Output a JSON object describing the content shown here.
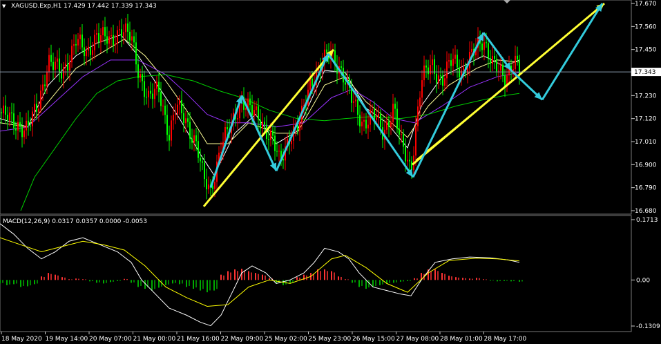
{
  "window": {
    "symbol_line": "XAGUSD.Exp,H1  17.429 17.442 17.339 17.343",
    "current_price_label": "17.343"
  },
  "colors": {
    "background": "#000000",
    "bull_candle": "#ff0000",
    "bear_candle": "#00ff00",
    "ma_fast": "#ffffff",
    "ma_mid": "#ffff99",
    "ma_slow": "#9933ff",
    "ma_long": "#00cc00",
    "trend_arrow": "#ffff33",
    "wave_arrow": "#33ccdd",
    "macd_line": "#ffffff",
    "signal_line": "#ffff00",
    "hist_pos": "#ff3333",
    "hist_neg": "#00aa00",
    "separator": "#888888",
    "price_line": "#8899aa"
  },
  "chart_data": [
    {
      "type": "candlestick",
      "symbol": "XAGUSD.Exp",
      "timeframe": "H1",
      "ohlc": {
        "open": 17.429,
        "high": 17.442,
        "low": 17.339,
        "close": 17.343
      },
      "ylim": [
        16.68,
        17.67
      ],
      "yticks": [
        16.68,
        16.79,
        16.9,
        17.01,
        17.12,
        17.23,
        17.34,
        17.45,
        17.56,
        17.67
      ],
      "ytick_labels": [
        "16.680",
        "16.790",
        "16.900",
        "17.010",
        "17.120",
        "17.230",
        "17.343",
        "17.450",
        "17.560",
        "17.670"
      ],
      "xtick_labels": [
        "18 May 2020",
        "19 May 14:00",
        "20 May 07:00",
        "21 May 00:00",
        "21 May 16:00",
        "22 May 09:00",
        "25 May 02:00",
        "25 May 23:00",
        "26 May 15:00",
        "27 May 08:00",
        "28 May 01:00",
        "28 May 17:00"
      ],
      "current_price": 17.343,
      "price_path": [
        [
          0,
          17.15
        ],
        [
          20,
          17.1
        ],
        [
          40,
          17.07
        ],
        [
          55,
          17.18
        ],
        [
          70,
          17.4
        ],
        [
          90,
          17.33
        ],
        [
          110,
          17.5
        ],
        [
          125,
          17.42
        ],
        [
          140,
          17.53
        ],
        [
          160,
          17.48
        ],
        [
          175,
          17.56
        ],
        [
          190,
          17.5
        ],
        [
          200,
          17.35
        ],
        [
          215,
          17.22
        ],
        [
          230,
          17.25
        ],
        [
          245,
          17.05
        ],
        [
          255,
          17.18
        ],
        [
          270,
          17.1
        ],
        [
          285,
          17.0
        ],
        [
          295,
          16.82
        ],
        [
          305,
          16.77
        ],
        [
          320,
          17.0
        ],
        [
          335,
          17.08
        ],
        [
          350,
          17.22
        ],
        [
          365,
          17.15
        ],
        [
          380,
          17.1
        ],
        [
          395,
          17.02
        ],
        [
          405,
          16.9
        ],
        [
          420,
          17.05
        ],
        [
          435,
          17.1
        ],
        [
          450,
          17.3
        ],
        [
          465,
          17.38
        ],
        [
          478,
          17.43
        ],
        [
          495,
          17.35
        ],
        [
          510,
          17.2
        ],
        [
          525,
          17.1
        ],
        [
          540,
          17.14
        ],
        [
          555,
          17.05
        ],
        [
          570,
          17.18
        ],
        [
          580,
          17.0
        ],
        [
          595,
          16.88
        ],
        [
          610,
          17.3
        ],
        [
          625,
          17.38
        ],
        [
          640,
          17.3
        ],
        [
          655,
          17.4
        ],
        [
          670,
          17.35
        ],
        [
          685,
          17.43
        ],
        [
          700,
          17.5
        ],
        [
          715,
          17.38
        ],
        [
          730,
          17.3
        ],
        [
          745,
          17.42
        ],
        [
          752,
          17.343
        ]
      ],
      "moving_averages": [
        {
          "key": "ma_fast",
          "points": [
            [
              0,
              17.12
            ],
            [
              40,
              17.08
            ],
            [
              70,
              17.28
            ],
            [
              110,
              17.42
            ],
            [
              140,
              17.48
            ],
            [
              175,
              17.52
            ],
            [
              200,
              17.42
            ],
            [
              230,
              17.27
            ],
            [
              260,
              17.12
            ],
            [
              290,
              16.95
            ],
            [
              310,
              16.85
            ],
            [
              340,
              17.05
            ],
            [
              370,
              17.14
            ],
            [
              400,
              17.0
            ],
            [
              430,
              17.06
            ],
            [
              470,
              17.35
            ],
            [
              500,
              17.34
            ],
            [
              530,
              17.17
            ],
            [
              560,
              17.1
            ],
            [
              590,
              16.98
            ],
            [
              610,
              17.18
            ],
            [
              640,
              17.32
            ],
            [
              670,
              17.37
            ],
            [
              700,
              17.42
            ],
            [
              730,
              17.37
            ],
            [
              752,
              17.4
            ]
          ]
        },
        {
          "key": "ma_mid",
          "points": [
            [
              0,
              17.1
            ],
            [
              40,
              17.08
            ],
            [
              70,
              17.2
            ],
            [
              110,
              17.36
            ],
            [
              150,
              17.44
            ],
            [
              180,
              17.5
            ],
            [
              210,
              17.42
            ],
            [
              240,
              17.3
            ],
            [
              270,
              17.16
            ],
            [
              300,
              17.0
            ],
            [
              330,
              17.0
            ],
            [
              360,
              17.1
            ],
            [
              400,
              17.05
            ],
            [
              430,
              17.05
            ],
            [
              470,
              17.28
            ],
            [
              500,
              17.32
            ],
            [
              530,
              17.2
            ],
            [
              560,
              17.12
            ],
            [
              590,
              17.03
            ],
            [
              620,
              17.18
            ],
            [
              650,
              17.28
            ],
            [
              690,
              17.36
            ],
            [
              720,
              17.4
            ],
            [
              752,
              17.39
            ]
          ]
        },
        {
          "key": "ma_slow",
          "points": [
            [
              0,
              17.06
            ],
            [
              40,
              17.08
            ],
            [
              80,
              17.2
            ],
            [
              120,
              17.32
            ],
            [
              160,
              17.4
            ],
            [
              200,
              17.4
            ],
            [
              240,
              17.33
            ],
            [
              270,
              17.24
            ],
            [
              300,
              17.14
            ],
            [
              330,
              17.1
            ],
            [
              360,
              17.1
            ],
            [
              400,
              17.08
            ],
            [
              440,
              17.1
            ],
            [
              480,
              17.22
            ],
            [
              510,
              17.26
            ],
            [
              540,
              17.2
            ],
            [
              570,
              17.12
            ],
            [
              600,
              17.1
            ],
            [
              640,
              17.18
            ],
            [
              680,
              17.27
            ],
            [
              720,
              17.32
            ],
            [
              752,
              17.34
            ]
          ]
        },
        {
          "key": "ma_long",
          "points": [
            [
              30,
              16.68
            ],
            [
              50,
              16.84
            ],
            [
              80,
              16.98
            ],
            [
              110,
              17.12
            ],
            [
              140,
              17.24
            ],
            [
              170,
              17.3
            ],
            [
              200,
              17.32
            ],
            [
              240,
              17.33
            ],
            [
              280,
              17.3
            ],
            [
              320,
              17.25
            ],
            [
              350,
              17.22
            ],
            [
              390,
              17.16
            ],
            [
              430,
              17.12
            ],
            [
              470,
              17.11
            ],
            [
              500,
              17.12
            ],
            [
              540,
              17.13
            ],
            [
              580,
              17.12
            ],
            [
              620,
              17.14
            ],
            [
              660,
              17.18
            ],
            [
              700,
              17.21
            ],
            [
              730,
              17.23
            ],
            [
              752,
              17.24
            ]
          ]
        }
      ],
      "annotations": {
        "trend_arrows": [
          {
            "from": [
              295,
              16.7
            ],
            "to": [
              483,
              17.45
            ]
          },
          {
            "from": [
              597,
              16.9
            ],
            "to": [
              875,
              17.67
            ]
          }
        ],
        "trend_lines": [
          {
            "from": [
              602,
              16.92
            ],
            "to": [
              760,
              17.35
            ]
          }
        ],
        "wave_path": [
          [
            305,
            16.79
          ],
          [
            350,
            17.23
          ],
          [
            400,
            16.87
          ],
          [
            475,
            17.43
          ],
          [
            598,
            16.84
          ],
          [
            700,
            17.53
          ],
          [
            740,
            17.35
          ],
          [
            785,
            17.21
          ],
          [
            872,
            17.67
          ]
        ]
      }
    },
    {
      "type": "macd",
      "title": "MACD(12,26,9) 0.0317 0.0357 0.0000 -0.0053",
      "ylim": [
        -0.1309,
        0.1713
      ],
      "yticks": [
        0.1713,
        0.0,
        -0.1309
      ],
      "ytick_labels": [
        "0.1713",
        "0.00",
        "-0.1309"
      ],
      "macd_line": [
        [
          0,
          0.16
        ],
        [
          20,
          0.13
        ],
        [
          40,
          0.09
        ],
        [
          60,
          0.06
        ],
        [
          80,
          0.08
        ],
        [
          100,
          0.11
        ],
        [
          120,
          0.12
        ],
        [
          145,
          0.1
        ],
        [
          170,
          0.08
        ],
        [
          190,
          0.05
        ],
        [
          205,
          0.0
        ],
        [
          225,
          -0.04
        ],
        [
          245,
          -0.08
        ],
        [
          270,
          -0.1
        ],
        [
          290,
          -0.12
        ],
        [
          305,
          -0.13
        ],
        [
          320,
          -0.1
        ],
        [
          335,
          -0.04
        ],
        [
          350,
          0.02
        ],
        [
          365,
          0.04
        ],
        [
          385,
          0.02
        ],
        [
          400,
          -0.01
        ],
        [
          420,
          0.0
        ],
        [
          440,
          0.02
        ],
        [
          455,
          0.05
        ],
        [
          470,
          0.09
        ],
        [
          490,
          0.08
        ],
        [
          505,
          0.06
        ],
        [
          520,
          0.02
        ],
        [
          540,
          -0.02
        ],
        [
          560,
          -0.03
        ],
        [
          580,
          -0.04
        ],
        [
          595,
          -0.045
        ],
        [
          610,
          0.0
        ],
        [
          630,
          0.05
        ],
        [
          655,
          0.06
        ],
        [
          680,
          0.065
        ],
        [
          710,
          0.063
        ],
        [
          735,
          0.057
        ],
        [
          752,
          0.05
        ]
      ],
      "signal_line": [
        [
          0,
          0.12
        ],
        [
          30,
          0.1
        ],
        [
          60,
          0.08
        ],
        [
          90,
          0.095
        ],
        [
          120,
          0.11
        ],
        [
          150,
          0.1
        ],
        [
          180,
          0.085
        ],
        [
          210,
          0.04
        ],
        [
          240,
          -0.02
        ],
        [
          270,
          -0.05
        ],
        [
          300,
          -0.075
        ],
        [
          330,
          -0.07
        ],
        [
          360,
          -0.02
        ],
        [
          390,
          0.0
        ],
        [
          420,
          -0.01
        ],
        [
          450,
          0.01
        ],
        [
          480,
          0.06
        ],
        [
          500,
          0.07
        ],
        [
          530,
          0.035
        ],
        [
          560,
          -0.01
        ],
        [
          590,
          -0.035
        ],
        [
          620,
          0.02
        ],
        [
          650,
          0.055
        ],
        [
          690,
          0.062
        ],
        [
          720,
          0.06
        ],
        [
          752,
          0.054
        ]
      ],
      "histogram": [
        [
          0,
          -0.01
        ],
        [
          10,
          -0.015
        ],
        [
          20,
          -0.012
        ],
        [
          30,
          -0.02
        ],
        [
          40,
          -0.018
        ],
        [
          50,
          -0.012
        ],
        [
          60,
          0.01
        ],
        [
          70,
          0.02
        ],
        [
          80,
          0.015
        ],
        [
          90,
          0.008
        ],
        [
          100,
          0.002
        ],
        [
          110,
          0.004
        ],
        [
          120,
          0.002
        ],
        [
          130,
          -0.004
        ],
        [
          140,
          -0.008
        ],
        [
          150,
          -0.01
        ],
        [
          160,
          -0.006
        ],
        [
          170,
          -0.003
        ],
        [
          180,
          0.003
        ],
        [
          190,
          -0.008
        ],
        [
          200,
          -0.02
        ],
        [
          210,
          -0.025
        ],
        [
          220,
          -0.03
        ],
        [
          230,
          -0.022
        ],
        [
          240,
          -0.015
        ],
        [
          250,
          -0.01
        ],
        [
          260,
          -0.012
        ],
        [
          270,
          -0.02
        ],
        [
          280,
          -0.025
        ],
        [
          290,
          -0.03
        ],
        [
          300,
          -0.035
        ],
        [
          310,
          -0.03
        ],
        [
          320,
          0.015
        ],
        [
          330,
          0.025
        ],
        [
          340,
          0.03
        ],
        [
          350,
          0.032
        ],
        [
          360,
          0.025
        ],
        [
          370,
          0.02
        ],
        [
          380,
          0.015
        ],
        [
          390,
          0.005
        ],
        [
          400,
          -0.01
        ],
        [
          410,
          -0.015
        ],
        [
          420,
          -0.01
        ],
        [
          430,
          0.008
        ],
        [
          440,
          0.015
        ],
        [
          450,
          0.02
        ],
        [
          460,
          0.03
        ],
        [
          470,
          0.03
        ],
        [
          480,
          0.025
        ],
        [
          490,
          0.01
        ],
        [
          500,
          0.002
        ],
        [
          510,
          -0.008
        ],
        [
          520,
          -0.02
        ],
        [
          530,
          -0.025
        ],
        [
          540,
          -0.02
        ],
        [
          550,
          -0.015
        ],
        [
          560,
          -0.01
        ],
        [
          570,
          -0.008
        ],
        [
          580,
          -0.005
        ],
        [
          590,
          -0.003
        ],
        [
          600,
          0.005
        ],
        [
          610,
          0.02
        ],
        [
          620,
          0.03
        ],
        [
          630,
          0.03
        ],
        [
          640,
          0.02
        ],
        [
          650,
          0.012
        ],
        [
          660,
          0.008
        ],
        [
          670,
          0.006
        ],
        [
          680,
          0.004
        ],
        [
          690,
          0.006
        ],
        [
          700,
          0.002
        ],
        [
          710,
          -0.002
        ],
        [
          720,
          -0.004
        ],
        [
          730,
          -0.003
        ],
        [
          740,
          -0.004
        ],
        [
          752,
          -0.005
        ]
      ]
    }
  ]
}
